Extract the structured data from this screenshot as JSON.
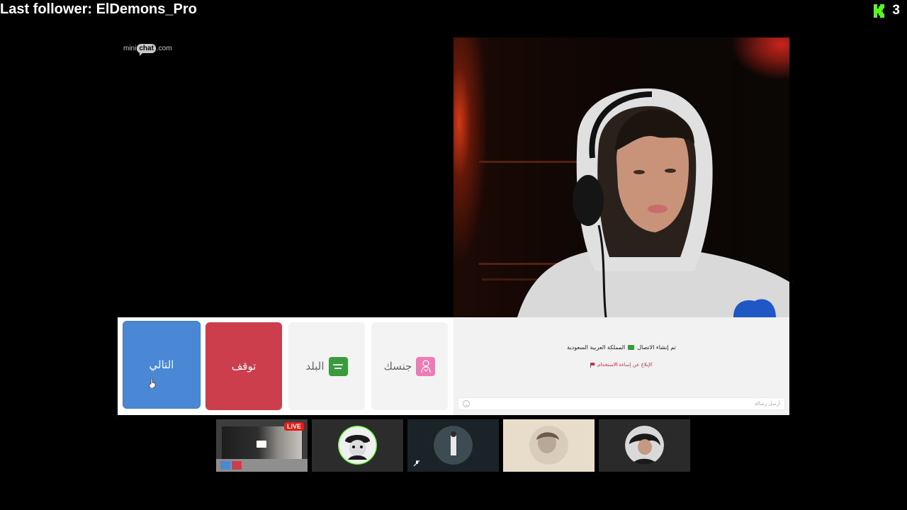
{
  "overlay": {
    "last_follower": "Last follower: ElDemons_Pro",
    "counter": "3",
    "counter_icon": "kick-logo-icon",
    "brand_color": "#53fc18"
  },
  "brand": {
    "prefix": "mini",
    "bubble": "chat",
    "suffix": ".com"
  },
  "controls": {
    "next_label": "التالي",
    "stop_label": "توقف",
    "country_label": "البلد",
    "gender_label": "جنسك",
    "next_color": "#4a88d6",
    "stop_color": "#cc3e4c"
  },
  "chat": {
    "connection_text": "تم إنشاء الاتصال",
    "country_name": "المملكة العربية السعودية",
    "report_text": "الإبلاغ عن إساءة الاستخدام",
    "input_placeholder": "أرسل رسالة"
  },
  "thumbnails": [
    {
      "name": "thumb-stream",
      "badge": "LIVE"
    },
    {
      "name": "thumb-cartoon-avatar"
    },
    {
      "name": "thumb-person-dark"
    },
    {
      "name": "thumb-person-light"
    },
    {
      "name": "thumb-person-hair"
    }
  ]
}
